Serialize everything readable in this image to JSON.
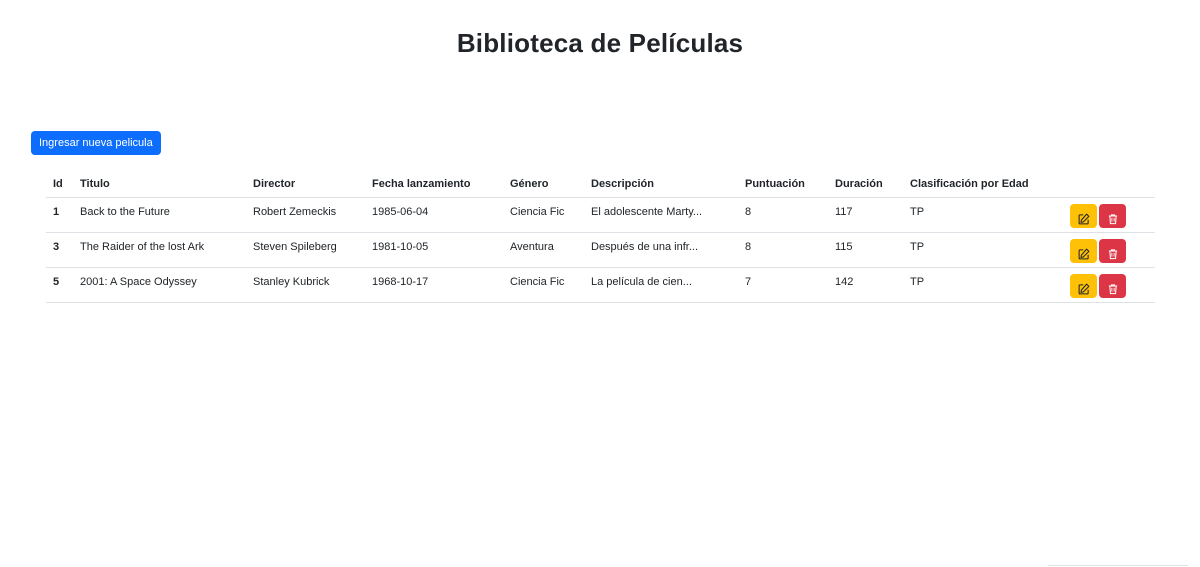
{
  "header": {
    "title": "Biblioteca de Películas"
  },
  "toolbar": {
    "new_movie_label": "Ingresar nueva pelicula"
  },
  "table": {
    "columns": [
      "Id",
      "Titulo",
      "Director",
      "Fecha lanzamiento",
      "Género",
      "Descripción",
      "Puntuación",
      "Duración",
      "Clasificación por Edad",
      ""
    ],
    "rows": [
      {
        "id": "1",
        "title": "Back to the Future",
        "director": "Robert Zemeckis",
        "release_date": "1985-06-04",
        "genre": "Ciencia Fic",
        "description": "El adolescente Marty...",
        "rating": "8",
        "duration": "117",
        "age_rating": "TP"
      },
      {
        "id": "3",
        "title": "The Raider of the lost Ark",
        "director": "Steven Spileberg",
        "release_date": "1981-10-05",
        "genre": "Aventura",
        "description": "Después de una infr...",
        "rating": "8",
        "duration": "115",
        "age_rating": "TP"
      },
      {
        "id": "5",
        "title": "2001: A Space Odyssey",
        "director": "Stanley Kubrick",
        "release_date": "1968-10-17",
        "genre": "Ciencia Fic",
        "description": "La película de cien...",
        "rating": "7",
        "duration": "142",
        "age_rating": "TP"
      }
    ]
  },
  "icons": {
    "edit": "pencil-square-icon",
    "delete": "trash-icon"
  },
  "colors": {
    "primary": "#0d6efd",
    "warning": "#ffc107",
    "danger": "#dc3545"
  }
}
